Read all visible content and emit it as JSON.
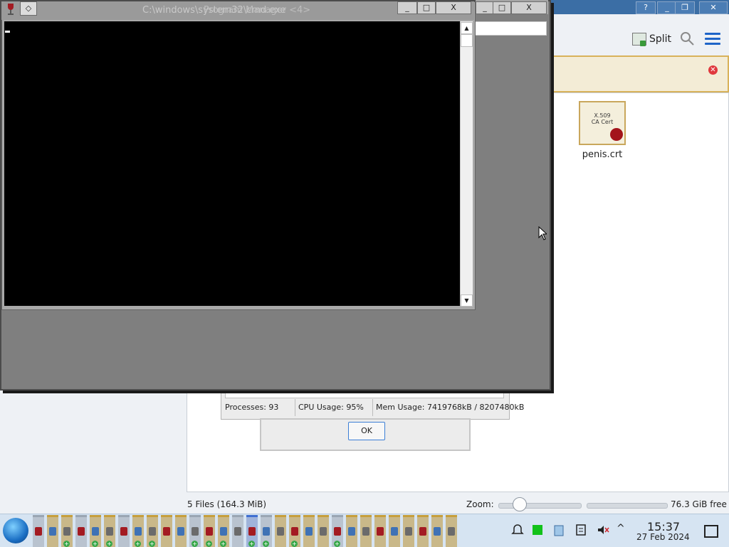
{
  "console_window": {
    "title": "C:\\windows\\system32\\cmd.exe",
    "title_overlay": "Program Manager <4>",
    "sys_button": "◇",
    "minimize": "_",
    "maximize": "□",
    "close": "X"
  },
  "outer_window": {
    "minimize": "_",
    "maximize": "□",
    "close": "X"
  },
  "file_manager": {
    "help": "?",
    "split_label": "Split",
    "file": {
      "name": "penis.crt",
      "icon_text": "X.509\nCA Cert"
    },
    "status": "5 Files (164.3 MiB)",
    "zoom_label": "Zoom:",
    "zoom_value": 0.25,
    "free_space": "76.3 GiB free"
  },
  "task_manager": {
    "processes": "Processes: 93",
    "cpu": "CPU Usage:  95%",
    "mem": "Mem Usage: 7419768kB / 8207480kB"
  },
  "dialog": {
    "ok": "OK"
  },
  "taskbar": {
    "clock_time": "15:37",
    "clock_date": "27 Feb 2024",
    "tray_chevron": "^"
  },
  "colors": {
    "accent": "#3b6ea5",
    "console_bg": "#000000",
    "taskbar": "#d6e4f2"
  }
}
